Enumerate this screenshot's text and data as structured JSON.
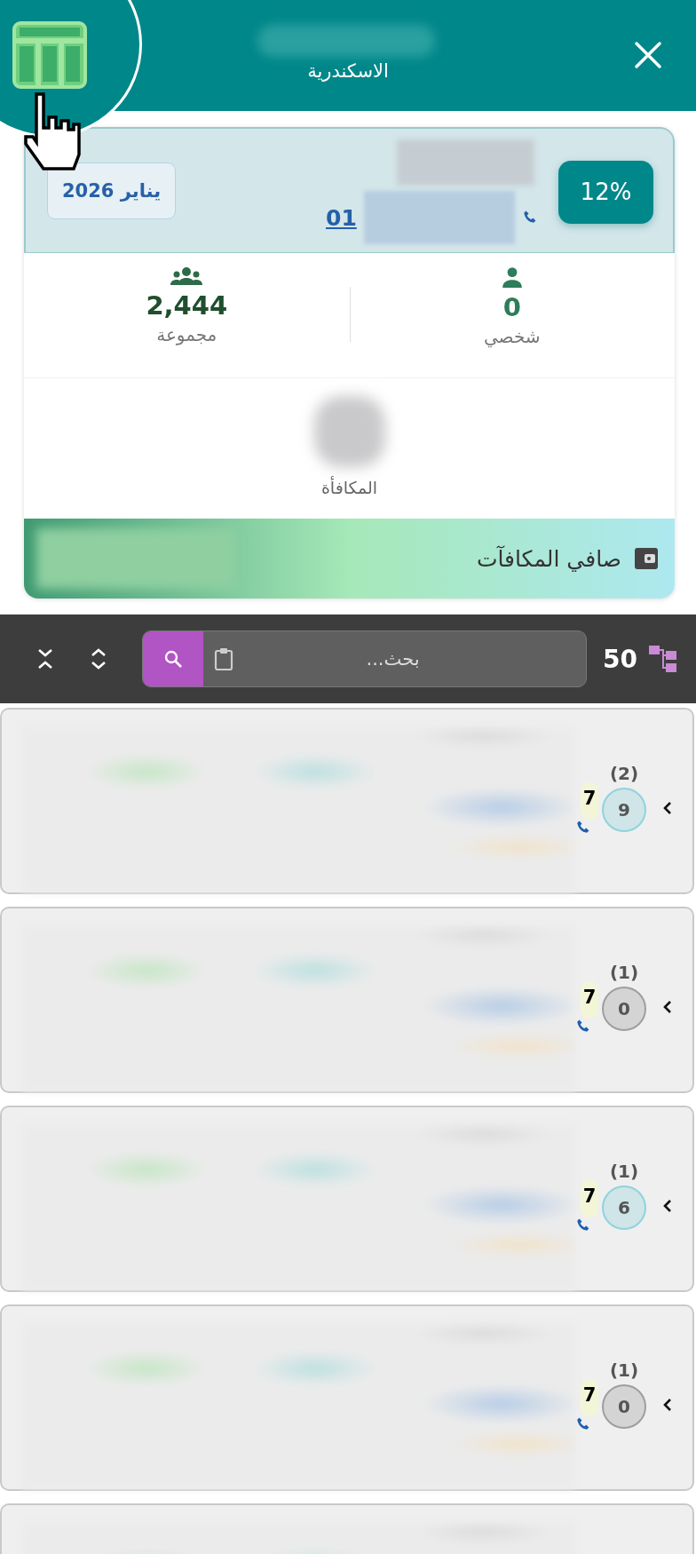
{
  "header": {
    "title": "الاسكندرية"
  },
  "summary": {
    "percent": "12%",
    "period": "يناير 2026",
    "phone_prefix": "01",
    "stats": [
      {
        "kind": "person",
        "value": "0",
        "label": "شخصي"
      },
      {
        "kind": "group",
        "value": "2,444",
        "label": "مجموعة"
      }
    ],
    "reward_label": "المكافأة",
    "net_label": "صافي المكافآت"
  },
  "toolbar": {
    "count": "50",
    "search": {
      "placeholder": "بحث..."
    }
  },
  "rows": [
    {
      "count": "(2)",
      "calls": "7",
      "badge": "9",
      "color": "#8fd3dc"
    },
    {
      "count": "(1)",
      "calls": "7",
      "badge": "0",
      "color": "#9e9e9e"
    },
    {
      "count": "(1)",
      "calls": "7",
      "badge": "6",
      "color": "#8fd3dc"
    },
    {
      "count": "(1)",
      "calls": "7",
      "badge": "0",
      "color": "#9e9e9e"
    }
  ]
}
